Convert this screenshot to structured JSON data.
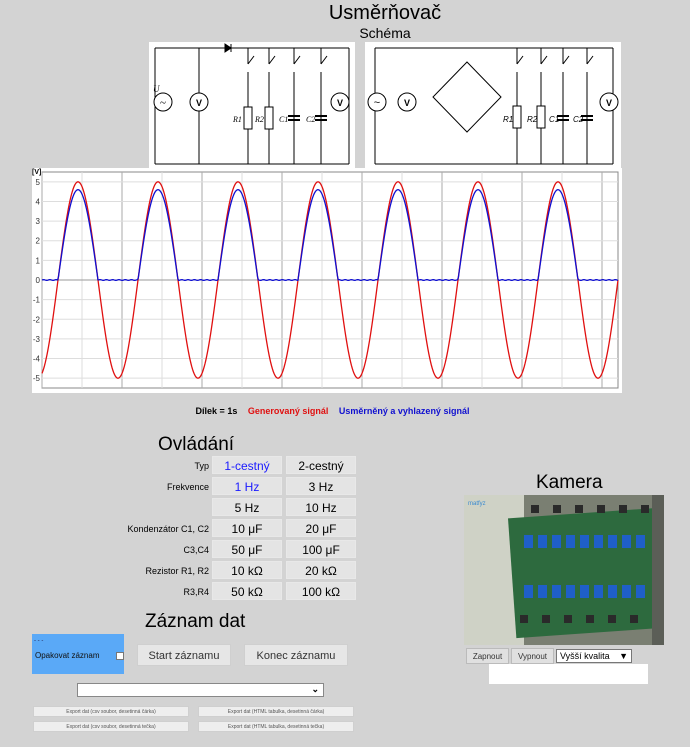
{
  "title": "Usměrňovač",
  "schema_title": "Schéma",
  "chart_data": {
    "type": "line",
    "ylabel": "[V]",
    "ylim": [
      -5.5,
      5.5
    ],
    "yticks": [
      5,
      4,
      3,
      2,
      1,
      0,
      -1,
      -2,
      -3,
      -4,
      -5
    ],
    "x": [
      0,
      0.5,
      1,
      1.5,
      2,
      2.5,
      3,
      3.5,
      4,
      4.5,
      5,
      5.5,
      6,
      6.5,
      7
    ],
    "xlim": [
      0,
      7.2
    ],
    "grid": true,
    "series": [
      {
        "name": "Generovaný signál",
        "color": "#e01010",
        "amplitude": 5,
        "frequency": 1
      },
      {
        "name": "Usměrněný a vyhlazený signál",
        "color": "#1010d0",
        "amplitude": 4.6,
        "frequency": 1
      }
    ]
  },
  "legend": {
    "division": "Dílek = 1s",
    "generated": "Generovaný signál",
    "rectified": "Usměrněný a vyhlazený signál"
  },
  "controls": {
    "heading": "Ovládání",
    "rows": [
      {
        "label": "Typ",
        "a": "1-cestný",
        "b": "2-cestný",
        "sel": "a"
      },
      {
        "label": "Frekvence",
        "a": "1 Hz",
        "b": "3 Hz",
        "sel": "a"
      },
      {
        "label": "",
        "a": "5 Hz",
        "b": "10 Hz",
        "sel": ""
      },
      {
        "label": "Kondenzátor C1, C2",
        "a": "10 μF",
        "b": "20 μF",
        "sel": ""
      },
      {
        "label": "C3,C4",
        "a": "50 μF",
        "b": "100 μF",
        "sel": ""
      },
      {
        "label": "Rezistor R1, R2",
        "a": "10 kΩ",
        "b": "20 kΩ",
        "sel": ""
      },
      {
        "label": "R3,R4",
        "a": "50 kΩ",
        "b": "100 kΩ",
        "sel": ""
      }
    ]
  },
  "recording": {
    "heading": "Záznam dat",
    "repeat_label": "Opakovat záznam",
    "start": "Start záznamu",
    "end": "Konec záznamu",
    "select_value": "",
    "exports": [
      "Export dat (csv soubor, desetinná čárka)",
      "Export dat (HTML tabulka, desetinná čárka)",
      "Export dat (csv soubor, desetinná tečka)",
      "Export dat (HTML tabulka, desetinná tečka)"
    ]
  },
  "camera": {
    "heading": "Kamera",
    "on": "Zapnout",
    "off": "Vypnout",
    "quality": "Vyšší kvalita",
    "logo": "matfyz"
  },
  "colors": {
    "background": "#d3d3d3",
    "generated": "#e01010",
    "rectified": "#1010d0",
    "selected_button": "#1a1aff",
    "repeat_box": "#5aa9f7"
  },
  "schema_labels": {
    "u": "U",
    "v": "V",
    "r1": "R1",
    "r2": "R2",
    "c1": "C1",
    "c2": "C2"
  }
}
